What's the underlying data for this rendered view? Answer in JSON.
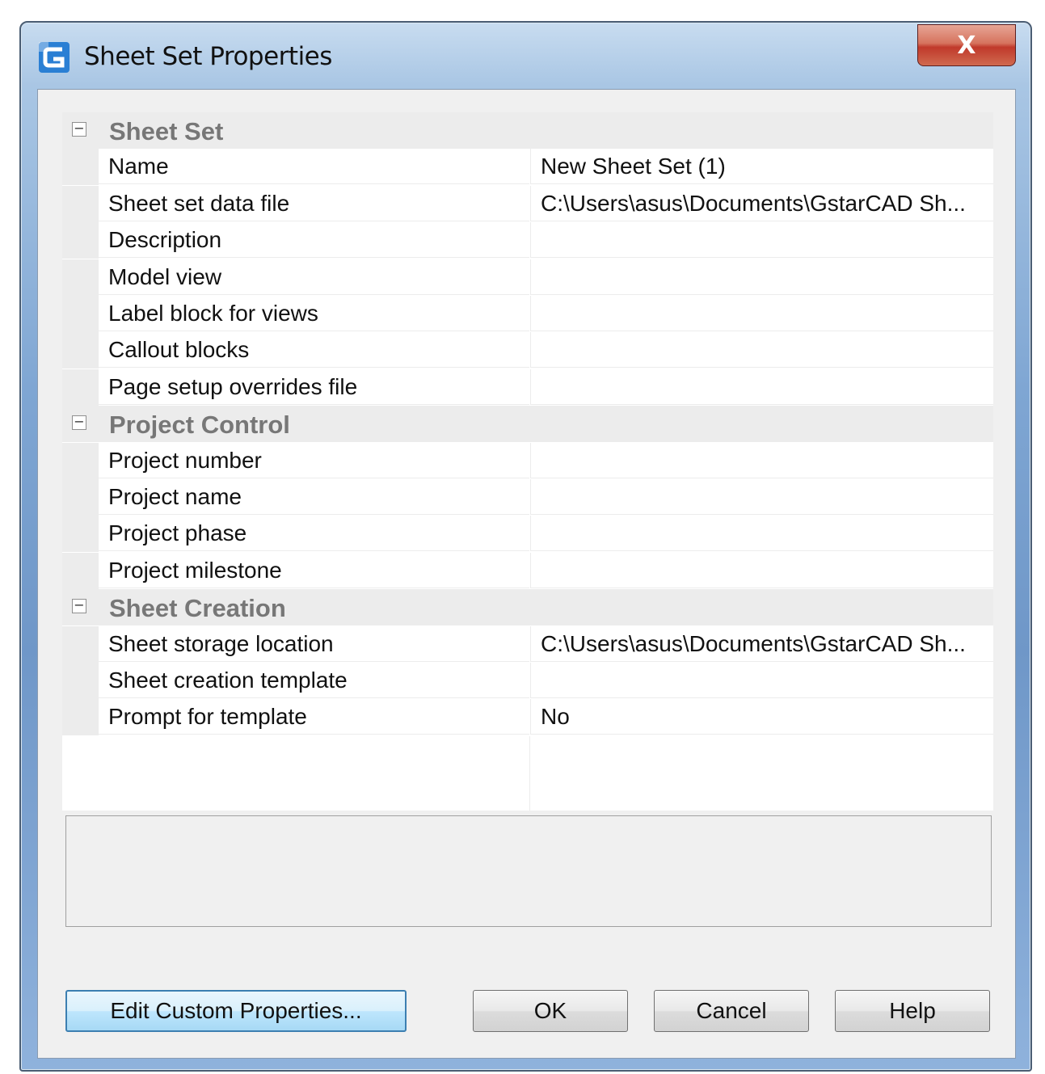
{
  "window": {
    "title": "Sheet Set Properties",
    "close_glyph": "X"
  },
  "categories": [
    {
      "label": "Sheet Set",
      "toggle": "−",
      "rows": [
        {
          "name": "Name",
          "value": "New Sheet Set (1)"
        },
        {
          "name": "Sheet set data file",
          "value": "C:\\Users\\asus\\Documents\\GstarCAD Sh..."
        },
        {
          "name": "Description",
          "value": ""
        },
        {
          "name": "Model view",
          "value": ""
        },
        {
          "name": "Label block for views",
          "value": ""
        },
        {
          "name": "Callout blocks",
          "value": ""
        },
        {
          "name": "Page setup overrides file",
          "value": ""
        }
      ]
    },
    {
      "label": "Project Control",
      "toggle": "−",
      "rows": [
        {
          "name": "Project number",
          "value": ""
        },
        {
          "name": "Project name",
          "value": ""
        },
        {
          "name": "Project phase",
          "value": ""
        },
        {
          "name": "Project milestone",
          "value": ""
        }
      ]
    },
    {
      "label": "Sheet Creation",
      "toggle": "−",
      "rows": [
        {
          "name": "Sheet storage location",
          "value": "C:\\Users\\asus\\Documents\\GstarCAD Sh..."
        },
        {
          "name": "Sheet creation template",
          "value": ""
        },
        {
          "name": "Prompt for template",
          "value": "No"
        }
      ]
    }
  ],
  "buttons": {
    "edit_custom": "Edit Custom Properties...",
    "ok": "OK",
    "cancel": "Cancel",
    "help": "Help"
  },
  "colors": {
    "accent": "#3c7fb1",
    "close": "#c0392b"
  }
}
